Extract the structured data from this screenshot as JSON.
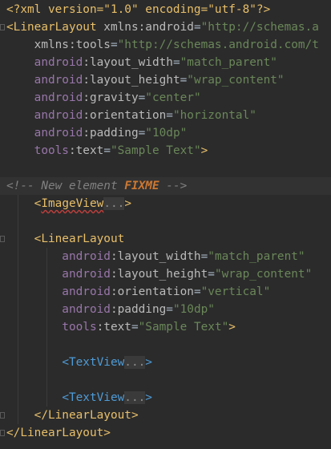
{
  "editor": {
    "lines": [
      {
        "id": "pi",
        "segments": [
          {
            "c": "t-pi",
            "t": "<?xml version=\"1.0\" encoding=\"utf-8\"?>"
          }
        ]
      },
      {
        "id": "root-open",
        "segments": [
          {
            "c": "t-tag",
            "t": "<LinearLayout "
          },
          {
            "c": "t-attr",
            "t": "xmlns:android"
          },
          {
            "c": "t-punct",
            "t": "="
          },
          {
            "c": "t-val",
            "t": "\"http://schemas.a"
          }
        ]
      },
      {
        "id": "xmlns-tools",
        "segments": [
          {
            "c": "t-attr",
            "t": "    xmlns:tools"
          },
          {
            "c": "t-punct",
            "t": "="
          },
          {
            "c": "t-val",
            "t": "\"http://schemas.android.com/t"
          }
        ]
      },
      {
        "id": "root-width",
        "segments": [
          {
            "c": "t-ns",
            "t": "    android"
          },
          {
            "c": "t-attr",
            "t": ":layout_width"
          },
          {
            "c": "t-punct",
            "t": "="
          },
          {
            "c": "t-val",
            "t": "\"match_parent\""
          }
        ]
      },
      {
        "id": "root-height",
        "segments": [
          {
            "c": "t-ns",
            "t": "    android"
          },
          {
            "c": "t-attr",
            "t": ":layout_height"
          },
          {
            "c": "t-punct",
            "t": "="
          },
          {
            "c": "t-val",
            "t": "\"wrap_content\""
          }
        ]
      },
      {
        "id": "root-gravity",
        "segments": [
          {
            "c": "t-ns",
            "t": "    android"
          },
          {
            "c": "t-attr",
            "t": ":gravity"
          },
          {
            "c": "t-punct",
            "t": "="
          },
          {
            "c": "t-val",
            "t": "\"center\""
          }
        ]
      },
      {
        "id": "root-orientation",
        "segments": [
          {
            "c": "t-ns",
            "t": "    android"
          },
          {
            "c": "t-attr",
            "t": ":orientation"
          },
          {
            "c": "t-punct",
            "t": "="
          },
          {
            "c": "t-val",
            "t": "\"horizontal\""
          }
        ]
      },
      {
        "id": "root-padding",
        "segments": [
          {
            "c": "t-ns",
            "t": "    android"
          },
          {
            "c": "t-attr",
            "t": ":padding"
          },
          {
            "c": "t-punct",
            "t": "="
          },
          {
            "c": "t-val",
            "t": "\"10dp\""
          }
        ]
      },
      {
        "id": "root-tools-text",
        "segments": [
          {
            "c": "t-ns",
            "t": "    tools"
          },
          {
            "c": "t-attr",
            "t": ":text"
          },
          {
            "c": "t-punct",
            "t": "="
          },
          {
            "c": "t-val",
            "t": "\"Sample Text\""
          },
          {
            "c": "t-tag",
            "t": ">"
          }
        ]
      },
      {
        "id": "blank-1",
        "segments": []
      },
      {
        "id": "comment",
        "hl": true,
        "segments": [
          {
            "c": "t-comment",
            "t": "<!-- New element "
          },
          {
            "c": "t-fixme",
            "t": "FIXME"
          },
          {
            "c": "t-comment",
            "t": " -->"
          }
        ]
      },
      {
        "id": "imageview",
        "segments": [
          {
            "c": "t-punct",
            "t": "    "
          },
          {
            "c": "t-tag",
            "t": "<"
          },
          {
            "c": "t-tag squiggle",
            "t": "ImageView"
          },
          {
            "c": "t-fold",
            "t": "..."
          },
          {
            "c": "t-tag",
            "t": ">"
          }
        ]
      },
      {
        "id": "blank-2",
        "segments": []
      },
      {
        "id": "inner-open",
        "segments": [
          {
            "c": "t-punct",
            "t": "    "
          },
          {
            "c": "t-tag",
            "t": "<LinearLayout"
          }
        ]
      },
      {
        "id": "inner-width",
        "segments": [
          {
            "c": "t-ns",
            "t": "        android"
          },
          {
            "c": "t-attr",
            "t": ":layout_width"
          },
          {
            "c": "t-punct",
            "t": "="
          },
          {
            "c": "t-val",
            "t": "\"match_parent\""
          }
        ]
      },
      {
        "id": "inner-height",
        "segments": [
          {
            "c": "t-ns",
            "t": "        android"
          },
          {
            "c": "t-attr",
            "t": ":layout_height"
          },
          {
            "c": "t-punct",
            "t": "="
          },
          {
            "c": "t-val",
            "t": "\"wrap_content\""
          }
        ]
      },
      {
        "id": "inner-orientation",
        "segments": [
          {
            "c": "t-ns",
            "t": "        android"
          },
          {
            "c": "t-attr",
            "t": ":orientation"
          },
          {
            "c": "t-punct",
            "t": "="
          },
          {
            "c": "t-val",
            "t": "\"vertical\""
          }
        ]
      },
      {
        "id": "inner-padding",
        "segments": [
          {
            "c": "t-ns",
            "t": "        android"
          },
          {
            "c": "t-attr",
            "t": ":padding"
          },
          {
            "c": "t-punct",
            "t": "="
          },
          {
            "c": "t-val",
            "t": "\"10dp\""
          }
        ]
      },
      {
        "id": "inner-tools-text",
        "segments": [
          {
            "c": "t-ns",
            "t": "        tools"
          },
          {
            "c": "t-attr",
            "t": ":text"
          },
          {
            "c": "t-punct",
            "t": "="
          },
          {
            "c": "t-val",
            "t": "\"Sample Text\""
          },
          {
            "c": "t-tag",
            "t": ">"
          }
        ]
      },
      {
        "id": "blank-3",
        "segments": []
      },
      {
        "id": "textview-1",
        "segments": [
          {
            "c": "t-punct",
            "t": "        "
          },
          {
            "c": "t-tag2",
            "t": "<TextView"
          },
          {
            "c": "t-fold",
            "t": "..."
          },
          {
            "c": "t-tag2",
            "t": ">"
          }
        ]
      },
      {
        "id": "blank-4",
        "segments": []
      },
      {
        "id": "textview-2",
        "segments": [
          {
            "c": "t-punct",
            "t": "        "
          },
          {
            "c": "t-tag2",
            "t": "<TextView"
          },
          {
            "c": "t-fold",
            "t": "..."
          },
          {
            "c": "t-tag2",
            "t": ">"
          }
        ]
      },
      {
        "id": "inner-close",
        "segments": [
          {
            "c": "t-punct",
            "t": "    "
          },
          {
            "c": "t-tag",
            "t": "</LinearLayout>"
          }
        ]
      },
      {
        "id": "root-close",
        "segments": [
          {
            "c": "t-tag",
            "t": "</LinearLayout>"
          }
        ]
      }
    ]
  }
}
